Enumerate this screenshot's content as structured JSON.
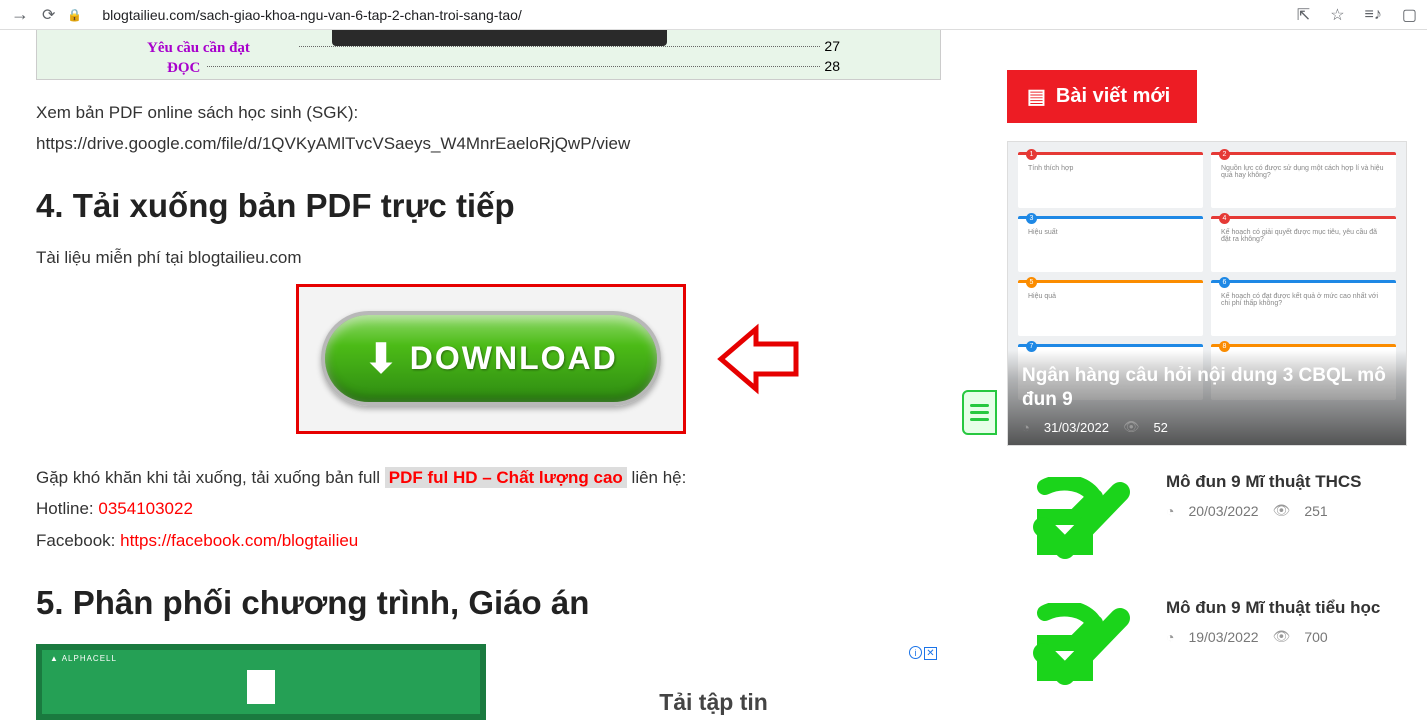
{
  "browser": {
    "url": "blogtailieu.com/sach-giao-khoa-ngu-van-6-tap-2-chan-troi-sang-tao/"
  },
  "thumb": {
    "line1": "Yêu cầu cần đạt",
    "line2": "ĐỌC",
    "p1": "27",
    "p2": "28"
  },
  "article": {
    "view_prefix": "Xem bản PDF online sách học sinh (SGK):",
    "view_url": "https://drive.google.com/file/d/1QVKyAMlTvcVSaeys_W4MnrEaeloRjQwP/view",
    "heading4": "4. Tải xuống bản PDF trực tiếp",
    "free_text": "Tài liệu miễn phí tại blogtailieu.com",
    "download_label": "DOWNLOAD",
    "trouble_prefix": "Gặp khó khăn khi tải xuống, tải xuống bản full ",
    "hd_label": "PDF ful HD – Chất lượng cao",
    "trouble_suffix": " liên hệ:",
    "hotline_label": "Hotline: ",
    "hotline_value": "0354103022",
    "fb_label": "Facebook: ",
    "fb_value": "https://facebook.com/blogtailieu",
    "heading5": "5. Phân phối chương trình, Giáo án"
  },
  "ad": {
    "brand": "▲ ALPHACELL",
    "title": "Tải tập tin"
  },
  "sidebar": {
    "widget_title": "Bài viết mới",
    "feature": {
      "title": "Ngân hàng câu hỏi nội dung 3 CBQL mô đun 9",
      "date": "31/03/2022",
      "views": "52",
      "cards": [
        {
          "color": "#e53935",
          "text": "Tính thích hợp"
        },
        {
          "color": "#e53935",
          "text": "Nguồn lực có được sử dụng một cách hợp lí và hiệu quả hay không?"
        },
        {
          "color": "#1e88e5",
          "text": "Hiệu suất"
        },
        {
          "color": "#e53935",
          "text": "Kế hoạch có giải quyết được mục tiêu, yêu cầu đã đặt ra không?"
        },
        {
          "color": "#fb8c00",
          "text": "Hiệu quả"
        },
        {
          "color": "#1e88e5",
          "text": "Kế hoạch có đạt được kết quả ở mức cao nhất với chi phí thấp không?"
        },
        {
          "color": "#1e88e5",
          "text": ""
        },
        {
          "color": "#fb8c00",
          "text": ""
        }
      ]
    },
    "posts": [
      {
        "title": "Mô đun 9 Mĩ thuật THCS",
        "date": "20/03/2022",
        "views": "251"
      },
      {
        "title": "Mô đun 9 Mĩ thuật tiểu học",
        "date": "19/03/2022",
        "views": "700"
      }
    ]
  }
}
